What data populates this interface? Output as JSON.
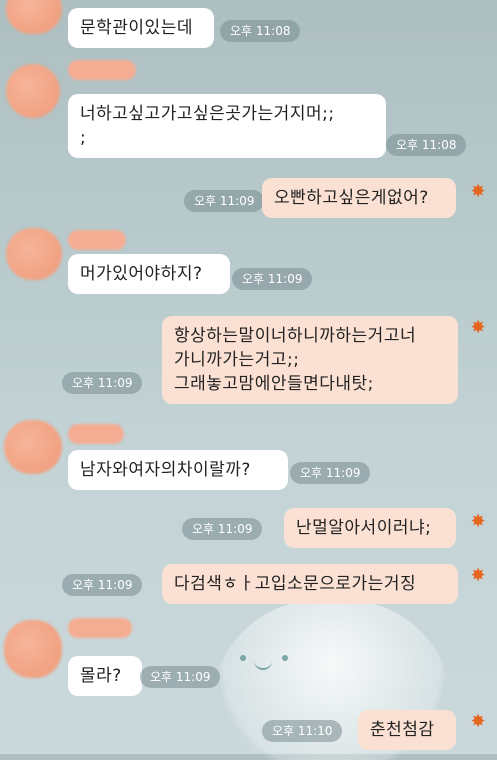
{
  "messages": [
    {
      "side": "in",
      "text": "문학관이있는데",
      "time": "오후 11:08"
    },
    {
      "side": "in",
      "text": "너하고싶고가고싶은곳가는거지머;;\n;",
      "time": "오후 11:08"
    },
    {
      "side": "out",
      "text": "오빤하고싶은게없어?",
      "time": "오후 11:09"
    },
    {
      "side": "in",
      "text": "머가있어야하지?",
      "time": "오후 11:09"
    },
    {
      "side": "out",
      "text": "항상하는말이너하니까하는거고너\n가니까가는거고;;\n그래놓고맘에안들면다내탓;",
      "time": "오후 11:09"
    },
    {
      "side": "in",
      "text": "남자와여자의차이랄까?",
      "time": "오후 11:09"
    },
    {
      "side": "out",
      "text": "난멀알아서이러냐;",
      "time": "오후 11:09"
    },
    {
      "side": "out",
      "text": "다검색ㅎㅏ고입소문으로가는거징",
      "time": "오후 11:09"
    },
    {
      "side": "in",
      "text": "몰라?",
      "time": "오후 11:09"
    },
    {
      "side": "out",
      "text": "춘천첨감",
      "time": "오후 11:10"
    }
  ],
  "colors": {
    "incoming_bubble": "#ffffff",
    "outgoing_bubble": "#fbe1d3",
    "accent_star": "#e5661f"
  },
  "icons": {
    "sender_marker": "sun-star-icon"
  }
}
